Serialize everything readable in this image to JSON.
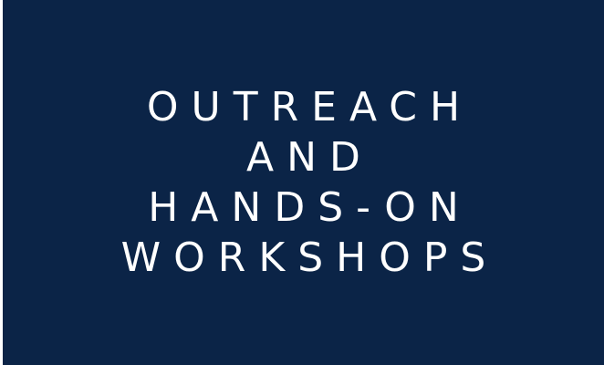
{
  "tile": {
    "background_color": "#0b2447",
    "text_color": "#ffffff",
    "lines": [
      "OUTREACH",
      "AND",
      "HANDS-ON",
      "WORKSHOPS"
    ]
  }
}
